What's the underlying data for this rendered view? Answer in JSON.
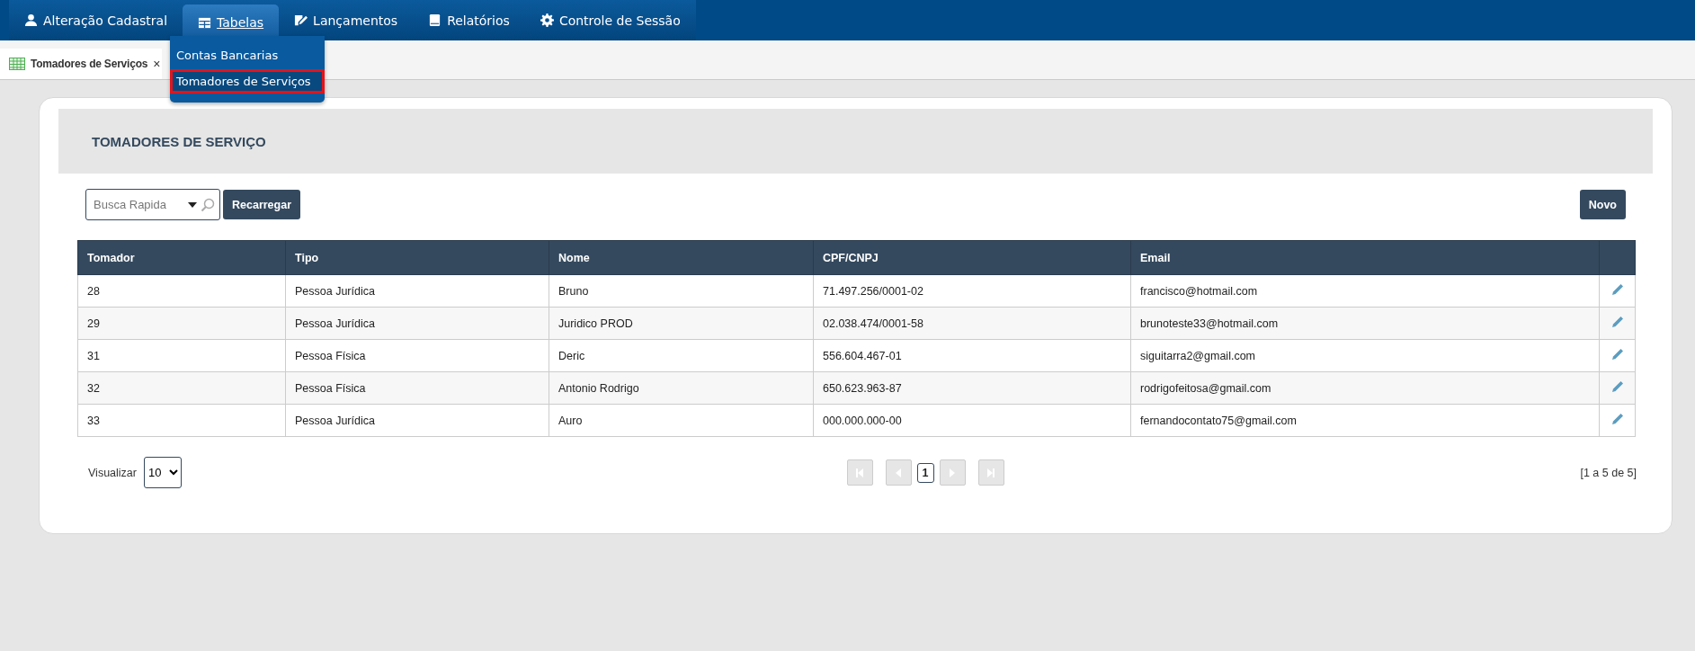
{
  "nav": {
    "items": [
      {
        "label": "Alteração Cadastral",
        "selected": false
      },
      {
        "label": "Tabelas",
        "selected": true
      },
      {
        "label": "Lançamentos",
        "selected": false
      },
      {
        "label": "Relatórios",
        "selected": false
      },
      {
        "label": "Controle de Sessão",
        "selected": false
      }
    ],
    "dropdown": [
      {
        "label": "Contas Bancarias",
        "selected": false
      },
      {
        "label": "Tomadores de Serviços",
        "selected": true
      }
    ]
  },
  "tabs": [
    {
      "label": "Tomadores de Serviços",
      "close": "×",
      "selected": true
    }
  ],
  "panel": {
    "title": "TOMADORES DE SERVIÇO",
    "search": {
      "placeholder": "Busca Rapida"
    },
    "buttons": {
      "reload": "Recarregar",
      "new": "Novo"
    },
    "table": {
      "columns": [
        "Tomador",
        "Tipo",
        "Nome",
        "CPF/CNPJ",
        "Email"
      ],
      "rows": [
        [
          "28",
          "Pessoa Jurídica",
          "Bruno",
          "71.497.256/0001-02",
          "francisco@hotmail.com"
        ],
        [
          "29",
          "Pessoa Jurídica",
          "Juridico PROD",
          "02.038.474/0001-58",
          "brunoteste33@hotmail.com"
        ],
        [
          "31",
          "Pessoa Física",
          "Deric",
          "556.604.467-01",
          "siguitarra2@gmail.com"
        ],
        [
          "32",
          "Pessoa Física",
          "Antonio Rodrigo",
          "650.623.963-87",
          "rodrigofeitosa@gmail.com"
        ],
        [
          "33",
          "Pessoa Jurídica",
          "Auro",
          "000.000.000-00",
          "fernandocontato75@gmail.com"
        ]
      ]
    },
    "footer": {
      "page_size_label": "Visualizar",
      "page_size": "10",
      "pages": [
        {
          "label": "1",
          "selected": true
        }
      ],
      "nav_disabled": true,
      "summary": "[1 a 5 de 5]"
    }
  }
}
